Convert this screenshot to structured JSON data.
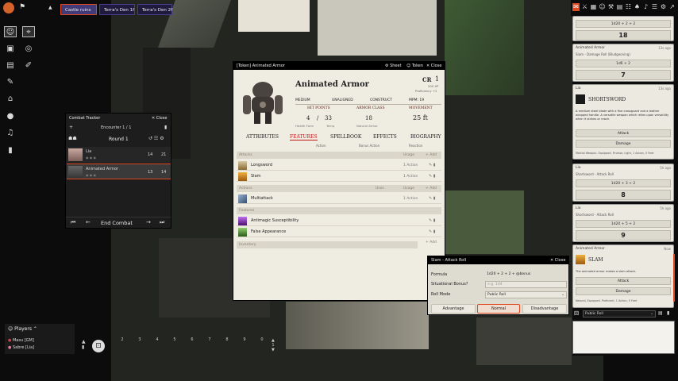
{
  "scene_tabs": [
    "Castle ruins",
    "Terra's Den 1f",
    "Terra's Den 2f"
  ],
  "sidebar_tabs": {
    "chat": "✉",
    "combat": "⚔",
    "scenes": "▦",
    "actors": "☺",
    "items": "⚒",
    "journal": "▤",
    "tables": "☷",
    "cards": "♠",
    "playlists": "♪",
    "compendium": "☰",
    "settings": "⚙",
    "popout": "↗"
  },
  "controls": {
    "token": "☺",
    "target": "⌖",
    "measure": "◎",
    "tiles": "▣",
    "draw": "✎",
    "notes": "⌂",
    "lighting": "●",
    "sound": "♫",
    "walls": "▤",
    "bookmark": "⚑"
  },
  "combat": {
    "title": "Combat Tracker",
    "close": "Close",
    "encounter": "Encounter 1 / 1",
    "round": "Round 1",
    "combatants": [
      {
        "name": "Lia",
        "init": "14",
        "hp": "21"
      },
      {
        "name": "Animated Armor",
        "init": "13",
        "hp": "14"
      }
    ],
    "end": "End Combat",
    "prev_round": "⏮",
    "prev_turn": "←",
    "next_turn": "→",
    "next_round": "⏭"
  },
  "sheet": {
    "window_title": "[Token] Animated Armor",
    "sheet_btn": "Sheet",
    "token_btn": "Token",
    "close_btn": "Close",
    "name": "Animated Armor",
    "cr_label": "CR",
    "cr": "1",
    "xp": "200 XP",
    "prof": "Proficiency +2",
    "size": "Medium",
    "alignment": "Unaligned",
    "type": "Construct",
    "mpm": "MPM: 19",
    "hp_label": "Hit Points",
    "hp_value": "4",
    "hp_max": "33",
    "ac_label": "Armor Class",
    "ac_value": "18",
    "speed_label": "Movement",
    "speed_value": "25 ft",
    "sub_health": "Health Form",
    "sub_temp": "Temp",
    "sub_ac": "Natural Armor",
    "tabs": [
      "Attributes",
      "Features",
      "Spellbook",
      "Effects",
      "Biography"
    ],
    "action_sub": "Action",
    "bonus_sub": "Bonus Action",
    "reaction_sub": "Reaction",
    "sections": {
      "attacks": "Attacks",
      "actions": "Actions",
      "features": "Features",
      "inventory": "Inventory",
      "usage": "Usage",
      "uses": "Uses",
      "add": "+ Add"
    },
    "attacks": [
      {
        "name": "Longsword",
        "use": "1 Action"
      },
      {
        "name": "Slam",
        "use": "1 Action"
      }
    ],
    "actions": [
      {
        "name": "Multiattack",
        "use": "1 Action"
      }
    ],
    "features": [
      {
        "name": "Antimagic Susceptibility"
      },
      {
        "name": "False Appearance"
      }
    ]
  },
  "roll": {
    "title": "Slam - Attack Roll",
    "close": "Close",
    "formula_label": "Formula",
    "formula": "1d20 + 2 + 2 + @bonus",
    "bonus_label": "Situational Bonus?",
    "bonus_placeholder": "e.g. 1d4",
    "mode_label": "Roll Mode",
    "mode": "Public Roll",
    "advantage": "Advantage",
    "normal": "Normal",
    "disadvantage": "Disadvantage"
  },
  "chat": [
    {
      "formula": "1d20 + 2 + 2",
      "total": "18"
    },
    {
      "speaker": "Animated Armor",
      "time": "13s ago",
      "flavor": "Slam - Damage Roll (Bludgeoning)",
      "formula": "1d6 + 2",
      "total": "7"
    },
    {
      "speaker": "Lia",
      "time": "13s ago",
      "item": "Shortsword",
      "desc": "A medium steel blade with a fine crossguard and a leather wrapped handle. A versatile weapon which relies upon versatility when it strikes or reach.",
      "attack": "Attack",
      "damage": "Damage",
      "props": "Martial Weapon, Equipped, Finesse, Light, 1 Action, 5 Feet"
    },
    {
      "speaker": "Lia",
      "time": "5h ago",
      "flavor": "Shortsword - Attack Roll",
      "formula": "1d20 + 3 + 2",
      "total": "8"
    },
    {
      "speaker": "Lia",
      "time": "5h ago",
      "flavor": "Shortsword - Attack Roll",
      "formula": "1d20 + 5 + 2",
      "total": "9"
    },
    {
      "speaker": "Animated Armor",
      "time": "Now",
      "item": "Slam",
      "desc": "The animated armor makes a slam attack.",
      "attack": "Attack",
      "damage": "Damage",
      "props": "Natural, Equipped, Proficient, 1 Action, 5 Feet"
    }
  ],
  "chat_mode": "Public Roll",
  "players": {
    "title": "Players",
    "list": [
      "Masu [GM]",
      "Sabre [Lia]"
    ]
  },
  "hotbar": [
    "1",
    "2",
    "3",
    "4",
    "5",
    "6",
    "7",
    "8",
    "9",
    "0"
  ],
  "page": "1",
  "colors": {
    "accent": "#e04a22",
    "tab_active": "#c01616",
    "player_gm": "#d04040",
    "player_2": "#e07aa0"
  }
}
